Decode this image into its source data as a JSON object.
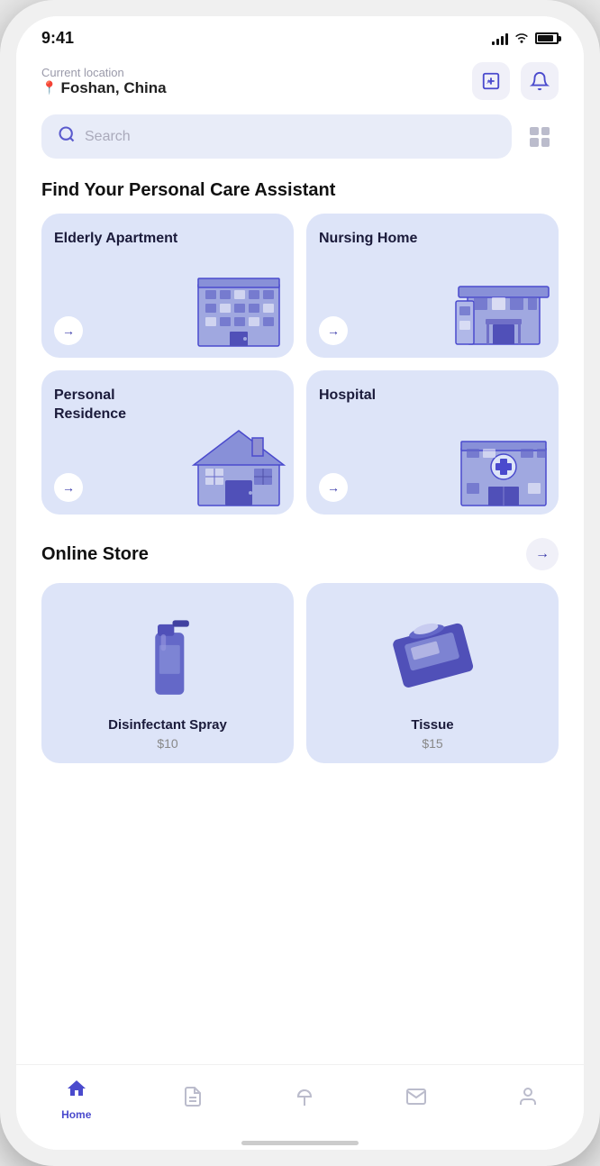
{
  "statusBar": {
    "time": "9:41"
  },
  "header": {
    "locationLabel": "Current location",
    "city": "Foshan, China"
  },
  "search": {
    "placeholder": "Search"
  },
  "careSection": {
    "title": "Find Your Personal Care Assistant",
    "cards": [
      {
        "id": "elderly-apartment",
        "title": "Elderly Apartment"
      },
      {
        "id": "nursing-home",
        "title": "Nursing Home"
      },
      {
        "id": "personal-residence",
        "title": "Personal Residence"
      },
      {
        "id": "hospital",
        "title": "Hospital"
      }
    ]
  },
  "storeSection": {
    "title": "Online Store",
    "products": [
      {
        "id": "disinfectant-spray",
        "name": "Disinfectant Spray",
        "price": "$10"
      },
      {
        "id": "tissue",
        "name": "Tissue",
        "price": "$15"
      }
    ]
  },
  "bottomNav": {
    "items": [
      {
        "id": "home",
        "label": "Home",
        "active": true
      },
      {
        "id": "documents",
        "label": "",
        "active": false
      },
      {
        "id": "plant",
        "label": "",
        "active": false
      },
      {
        "id": "mail",
        "label": "",
        "active": false
      },
      {
        "id": "profile",
        "label": "",
        "active": false
      }
    ]
  }
}
